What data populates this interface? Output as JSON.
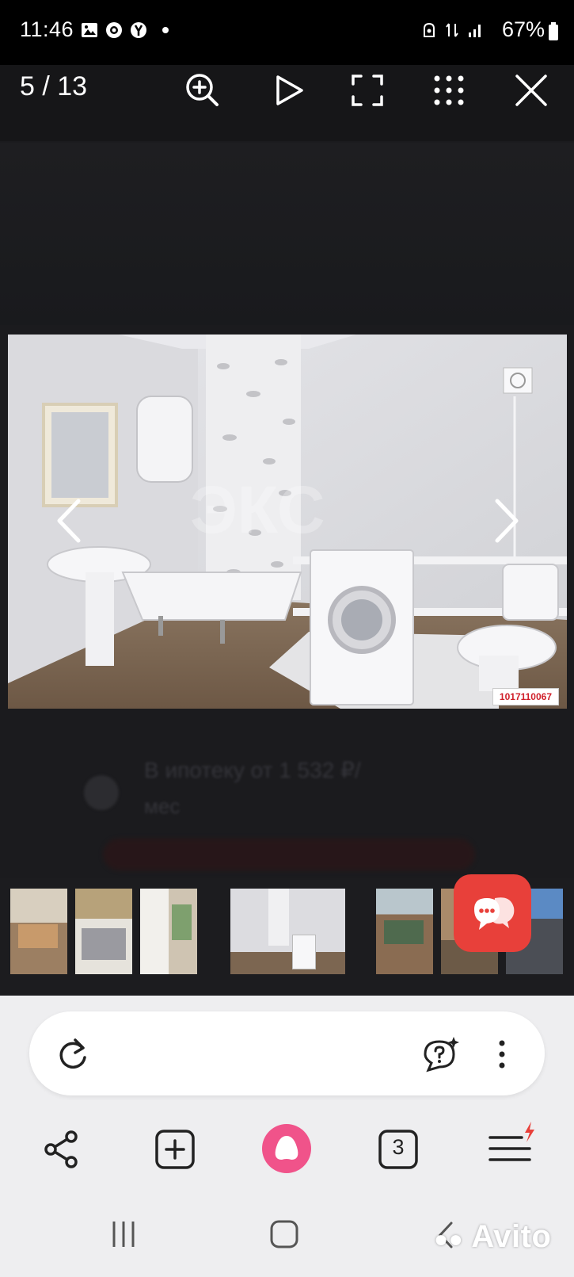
{
  "status": {
    "time": "11:46",
    "battery": "67%"
  },
  "viewer": {
    "counter": "5 / 13",
    "listing_id": "1017110067",
    "background_text": "В ипотеку от 1 532 ₽/",
    "background_sub": "мес"
  },
  "thumbnails": {
    "count": 8,
    "active_index": 3
  },
  "browser": {
    "tabs_count": "3"
  },
  "watermark": "Avito",
  "colors": {
    "chat_fab": "#e8403a",
    "alice": "#f0538a",
    "listing_id": "#d0202a"
  }
}
